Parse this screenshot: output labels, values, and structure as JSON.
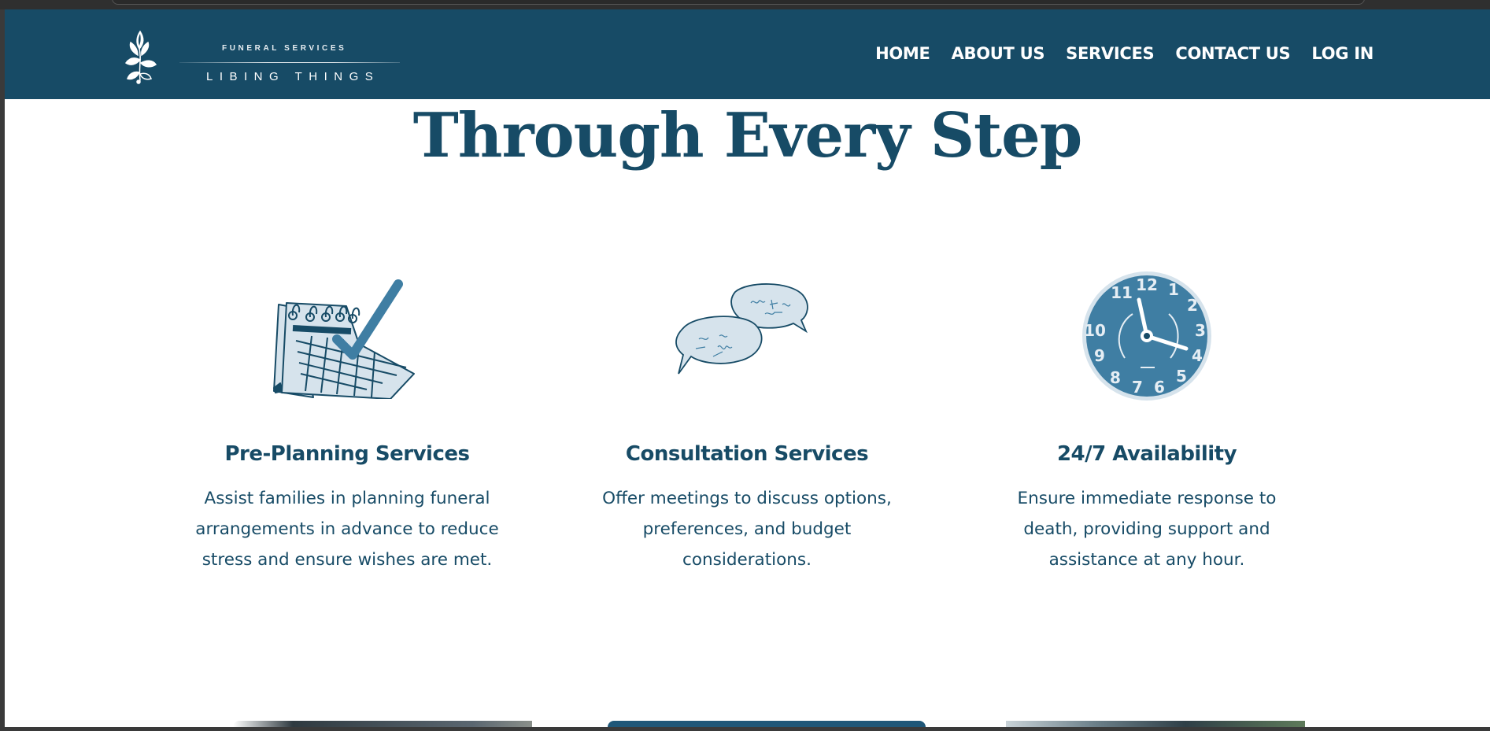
{
  "brand": {
    "tagline": "FUNERAL SERVICES",
    "name": "LIBING THINGS",
    "logo_icon": "leaf-sprig-icon"
  },
  "nav": {
    "items": [
      {
        "label": "HOME"
      },
      {
        "label": "ABOUT US"
      },
      {
        "label": "SERVICES"
      },
      {
        "label": "CONTACT US"
      },
      {
        "label": "LOG IN"
      }
    ]
  },
  "headline": "Through Every Step",
  "services": [
    {
      "icon": "calendar-check-icon",
      "title": "Pre-Planning Services",
      "description": "Assist families in planning funeral arrangements in advance to reduce stress and ensure wishes are met."
    },
    {
      "icon": "speech-bubbles-icon",
      "title": "Consultation Services",
      "description": "Offer meetings to discuss options, preferences, and budget considerations."
    },
    {
      "icon": "clock-icon",
      "title": "24/7 Availability",
      "description": "Ensure immediate response to death, providing support and assistance at any hour."
    }
  ],
  "colors": {
    "brand_navy": "#174b66",
    "icon_blue": "#3f7ea3",
    "icon_light": "#d6e3ec",
    "background": "#ffffff"
  }
}
